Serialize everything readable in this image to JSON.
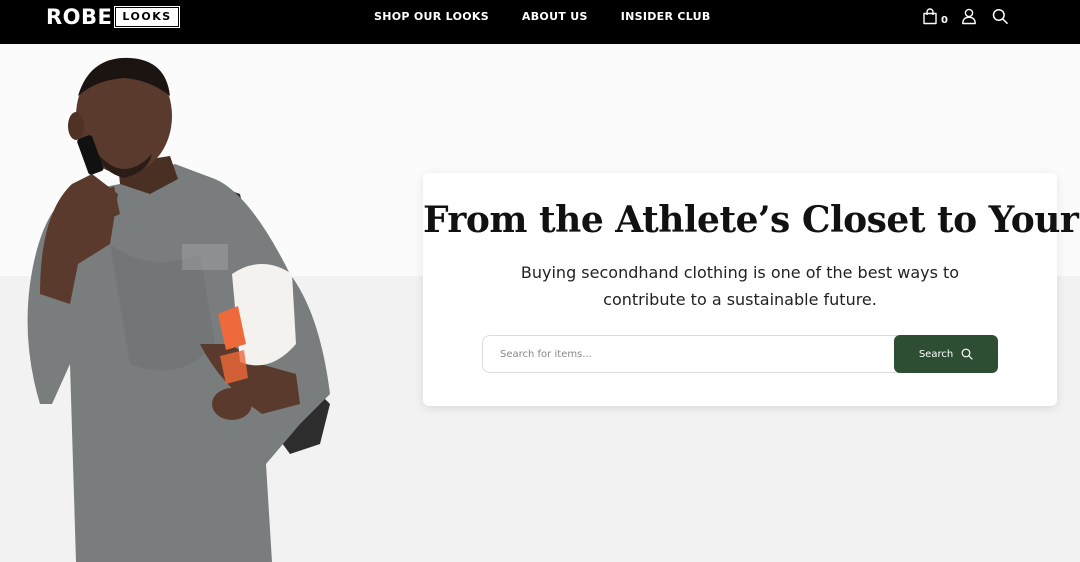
{
  "header": {
    "logo_primary": "ROBE",
    "logo_secondary": "LOOKS",
    "nav": [
      {
        "label": "SHOP OUR LOOKS"
      },
      {
        "label": "ABOUT US"
      },
      {
        "label": "INSIDER CLUB"
      }
    ],
    "cart_count": "0",
    "icons": [
      "shopping-bag-icon",
      "user-icon",
      "search-icon"
    ]
  },
  "hero": {
    "title": "From the Athlete’s Closet to Yours",
    "subtitle": "Buying secondhand clothing is one of the best ways to contribute to a sustainable future.",
    "search": {
      "placeholder": "Search for items...",
      "value": "",
      "button_label": "Search",
      "button_icon": "search-icon"
    }
  },
  "colors": {
    "header_bg": "#000000",
    "accent_green": "#2e4e34",
    "hero_bg_top": "#fbfbfb",
    "hero_bg_bottom": "#f2f2f2"
  }
}
